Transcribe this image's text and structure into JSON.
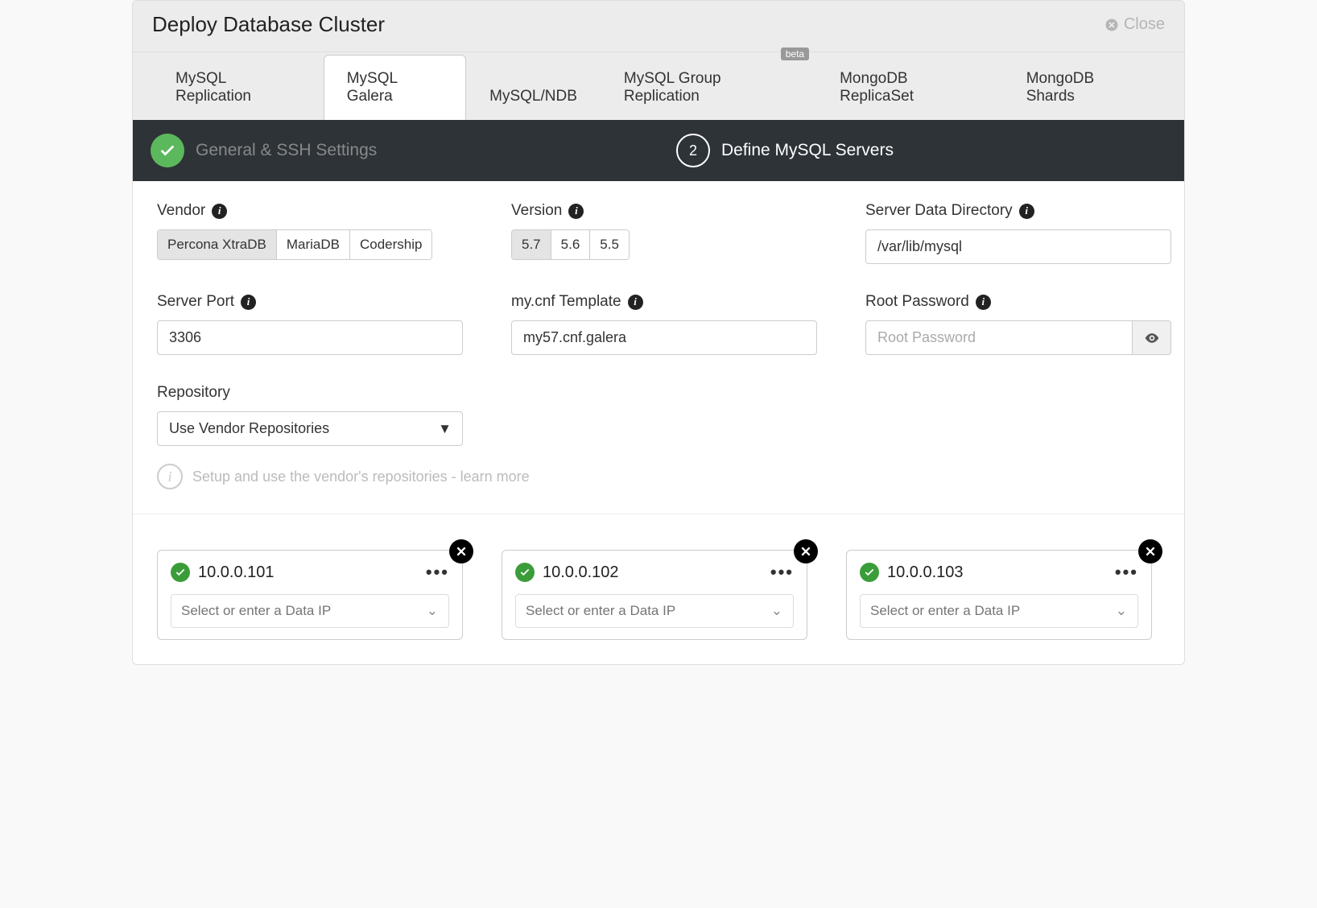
{
  "header": {
    "title": "Deploy Database Cluster",
    "close_label": "Close"
  },
  "tabs": [
    {
      "label": "MySQL Replication"
    },
    {
      "label": "MySQL Galera",
      "active": true
    },
    {
      "label": "MySQL/NDB"
    },
    {
      "label": "MySQL Group Replication",
      "badge": "beta"
    },
    {
      "label": "MongoDB ReplicaSet"
    },
    {
      "label": "MongoDB Shards"
    }
  ],
  "steps": {
    "s1": {
      "label": "General & SSH Settings"
    },
    "s2": {
      "number": "2",
      "label": "Define MySQL Servers"
    }
  },
  "form": {
    "vendor": {
      "label": "Vendor",
      "options": [
        "Percona XtraDB",
        "MariaDB",
        "Codership"
      ],
      "selected": "Percona XtraDB"
    },
    "version": {
      "label": "Version",
      "options": [
        "5.7",
        "5.6",
        "5.5"
      ],
      "selected": "5.7"
    },
    "data_dir": {
      "label": "Server Data Directory",
      "value": "/var/lib/mysql"
    },
    "port": {
      "label": "Server Port",
      "value": "3306"
    },
    "mycnf": {
      "label": "my.cnf Template",
      "value": "my57.cnf.galera"
    },
    "root_pw": {
      "label": "Root Password",
      "placeholder": "Root Password",
      "value": ""
    },
    "repo": {
      "label": "Repository",
      "value": "Use Vendor Repositories",
      "hint": "Setup and use the vendor's repositories - learn more"
    }
  },
  "servers": [
    {
      "ip": "10.0.0.101",
      "data_ip_placeholder": "Select or enter a Data IP"
    },
    {
      "ip": "10.0.0.102",
      "data_ip_placeholder": "Select or enter a Data IP"
    },
    {
      "ip": "10.0.0.103",
      "data_ip_placeholder": "Select or enter a Data IP"
    }
  ]
}
